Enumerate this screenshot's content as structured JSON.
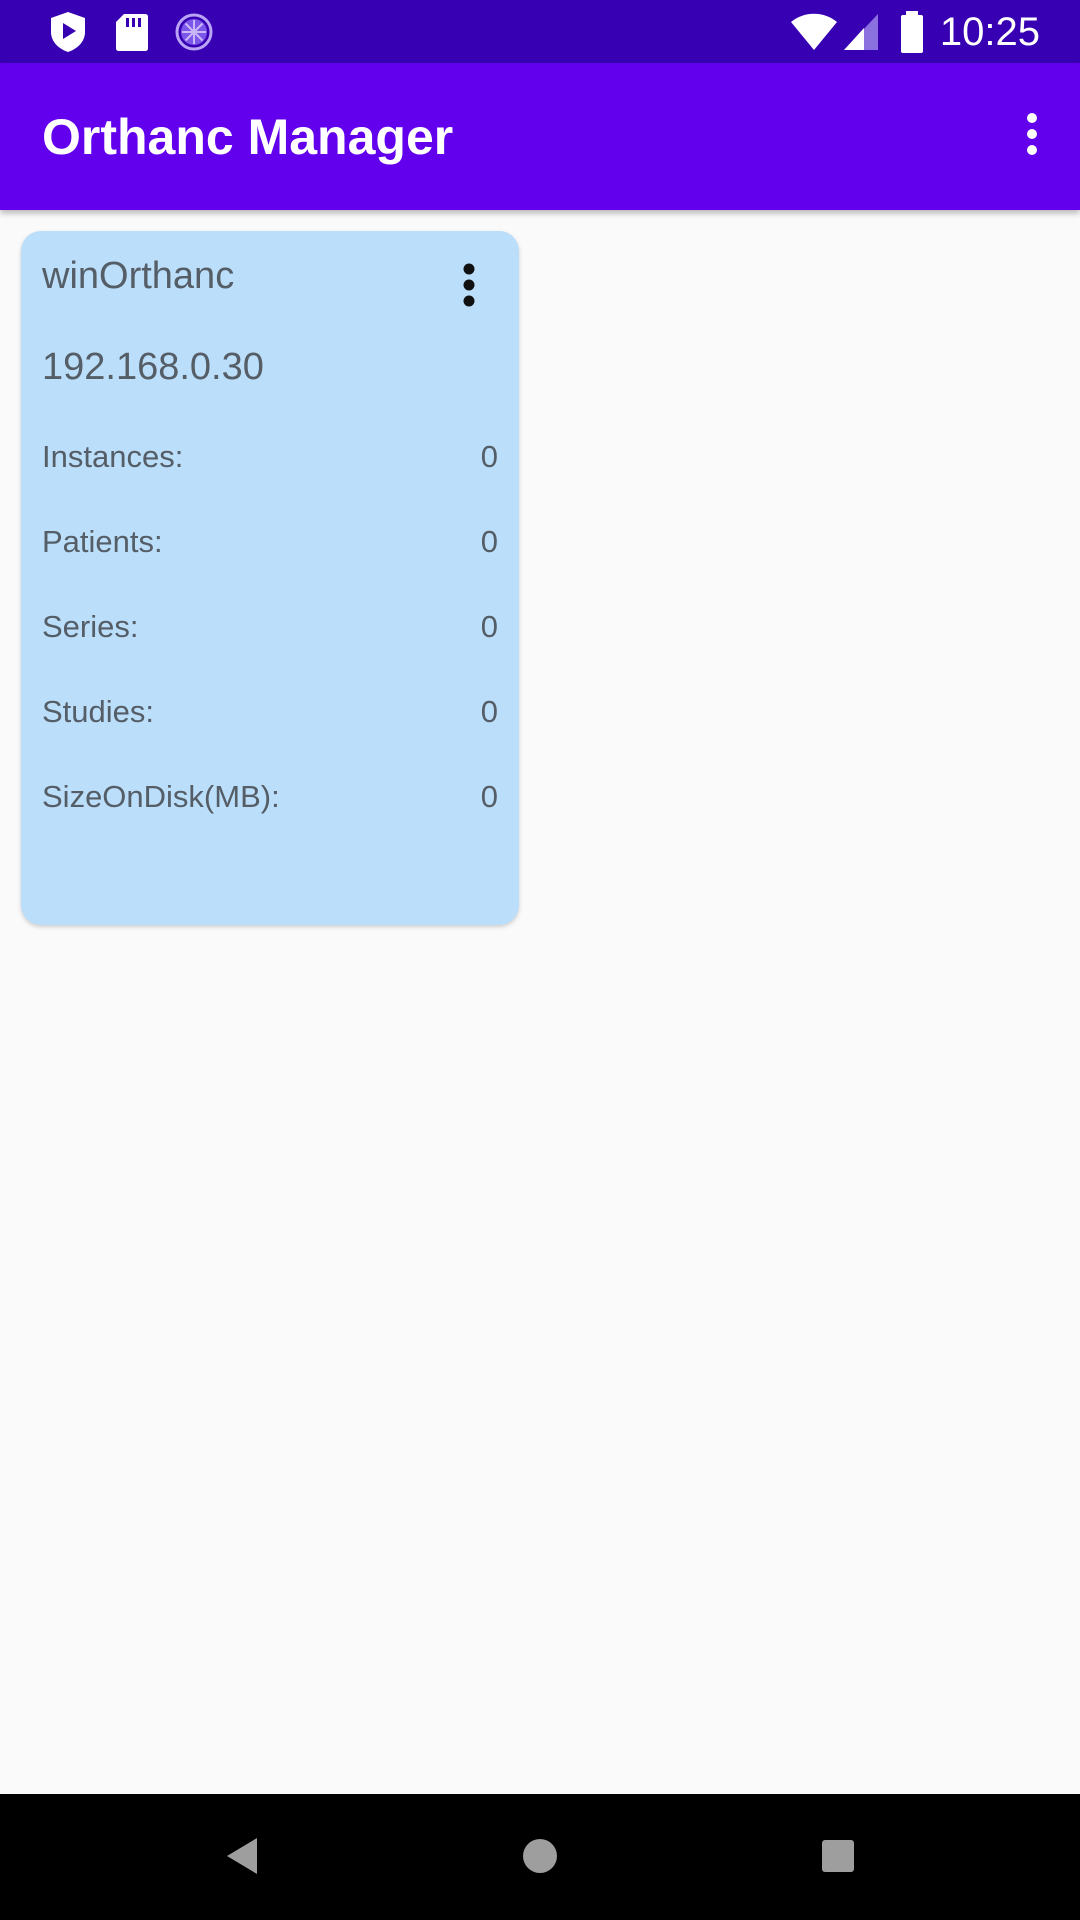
{
  "status_bar": {
    "time": "10:25",
    "left_icons": [
      "shield-notification-icon",
      "sd-card-icon",
      "sync-progress-icon"
    ],
    "right_icons": [
      "wifi-icon",
      "cell-signal-icon",
      "battery-icon"
    ]
  },
  "app_bar": {
    "title": "Orthanc Manager",
    "overflow_icon": "more-vert-icon"
  },
  "server_card": {
    "name": "winOrthanc",
    "ip": "192.168.0.30",
    "stats": [
      {
        "label": "Instances:",
        "value": "0"
      },
      {
        "label": "Patients:",
        "value": "0"
      },
      {
        "label": "Series:",
        "value": "0"
      },
      {
        "label": "Studies:",
        "value": "0"
      },
      {
        "label": "SizeOnDisk(MB):",
        "value": "0"
      }
    ]
  },
  "nav_bar": {
    "buttons": [
      "back-icon",
      "home-icon",
      "recents-icon"
    ]
  },
  "colors": {
    "status_bar": "#3700B3",
    "app_bar": "#6200EE",
    "card_background": "#BBDEFB",
    "card_text": "#555E66",
    "page_background": "#FAFAFA",
    "nav_bar": "#000000"
  }
}
